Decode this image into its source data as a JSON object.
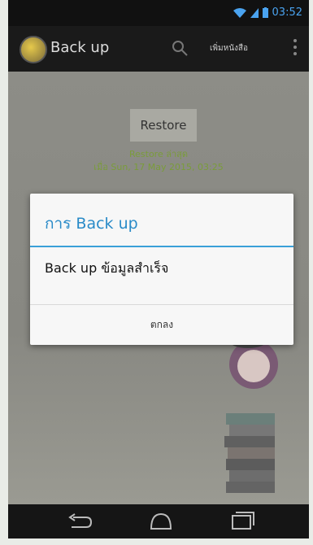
{
  "status": {
    "time": "03:52"
  },
  "actionbar": {
    "title": "Back up",
    "action_text": "เพิ่มหนังสือ"
  },
  "main": {
    "restore_button": "Restore",
    "restore_status_line1": "Restore ล่าสุด",
    "restore_status_line2": "เมื่อ Sun, 17 May 2015, 03:25"
  },
  "dialog": {
    "title": "การ Back up",
    "message": "Back up ข้อมูลสำเร็จ",
    "ok_button": "ตกลง"
  },
  "colors": {
    "dialog_accent": "#2a8bc8",
    "status_text": "#7a9c3a"
  },
  "icons": [
    "wifi-icon",
    "signal-icon",
    "battery-icon",
    "search-icon",
    "overflow-menu-icon",
    "back-icon",
    "home-icon",
    "recent-apps-icon"
  ]
}
